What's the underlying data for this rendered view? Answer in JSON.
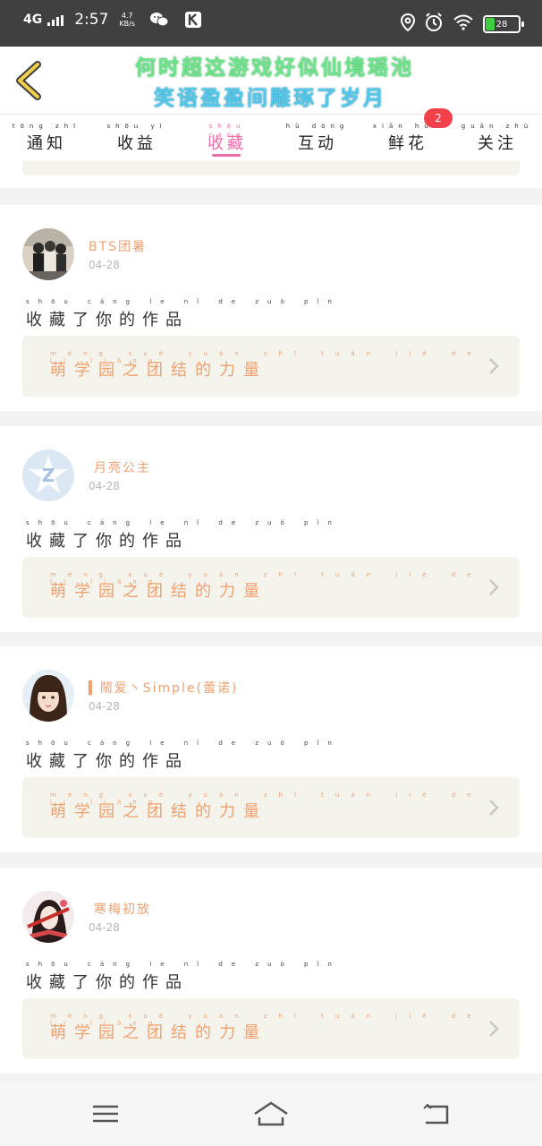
{
  "status_bar": {
    "network": "4G",
    "time": "2:57",
    "speed_value": "4.7",
    "speed_unit": "KB/s",
    "battery": "28"
  },
  "header": {
    "title_line1": "何时超这游戏好似仙境瑶池",
    "title_line2": "笑语盈盈间雕琢了岁月"
  },
  "tabs": [
    {
      "label": "通知",
      "pinyin": "tōng zhī"
    },
    {
      "label": "收益",
      "pinyin": "shōu yì"
    },
    {
      "label": "收藏",
      "pinyin": "shōu cáng",
      "active": true
    },
    {
      "label": "互动",
      "pinyin": "hù dòng"
    },
    {
      "label": "鲜花",
      "pinyin": "xiān huā",
      "badge": "2"
    },
    {
      "label": "关注",
      "pinyin": "guān zhù"
    }
  ],
  "items": [
    {
      "user": "BTS团暑",
      "date": "04-28",
      "action": "收藏了你的作品",
      "action_pinyin": "shōu cáng le nǐ de zuò pǐn",
      "work_title": "萌学园之团结的力量",
      "work_pinyin": "méng xué yuán zhī tuán jié de lì liàng"
    },
    {
      "user": "月亮公主",
      "date": "04-28",
      "action": "收藏了你的作品",
      "action_pinyin": "shōu cáng le nǐ de zuò pǐn",
      "work_title": "萌学园之团结的力量",
      "work_pinyin": "méng xué yuán zhī tuán jié de lì liàng"
    },
    {
      "user": "▍鬧爱丶Simple(蕾诺)",
      "date": "04-28",
      "action": "收藏了你的作品",
      "action_pinyin": "shōu cáng le nǐ de zuò pǐn",
      "work_title": "萌学园之团结的力量",
      "work_pinyin": "méng xué yuán zhī tuán jié de lì liàng"
    },
    {
      "user": "寒梅初放",
      "date": "04-28",
      "action": "收藏了你的作品",
      "action_pinyin": "shōu cáng le nǐ de zuò pǐn",
      "work_title": "萌学园之团结的力量",
      "work_pinyin": "méng xué yuán zhī tuán jié de lì liàng"
    }
  ],
  "colors": {
    "accent": "#ee6ea8",
    "badge": "#f2414b",
    "work_text": "#f0a070",
    "card_box": "#f5f4ec"
  }
}
